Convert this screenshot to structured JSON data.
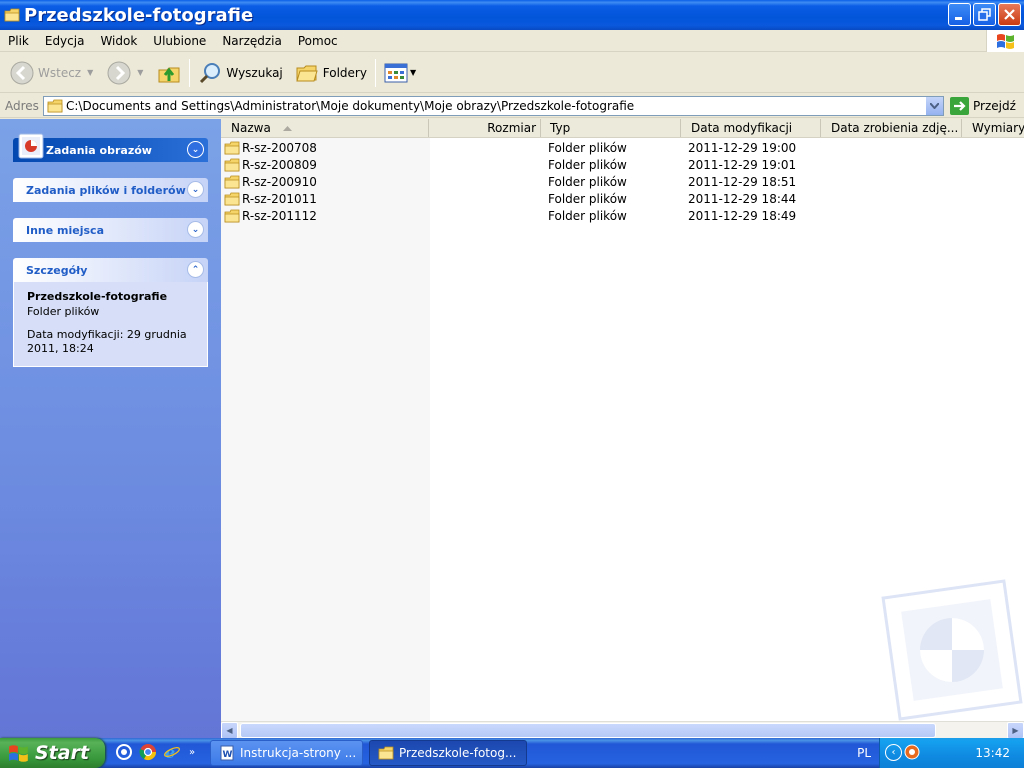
{
  "window": {
    "title": "Przedszkole-fotografie"
  },
  "menu": {
    "items": [
      "Plik",
      "Edycja",
      "Widok",
      "Ulubione",
      "Narzędzia",
      "Pomoc"
    ]
  },
  "toolbar": {
    "back_label": "Wstecz",
    "search_label": "Wyszukaj",
    "folders_label": "Foldery"
  },
  "address": {
    "label": "Adres",
    "path": "C:\\Documents and Settings\\Administrator\\Moje dokumenty\\Moje obrazy\\Przedszkole-fotografie",
    "go_label": "Przejdź"
  },
  "taskpane": {
    "picture_tasks": "Zadania obrazów",
    "file_tasks": "Zadania plików i folderów",
    "other_places": "Inne miejsca",
    "details": {
      "header": "Szczegóły",
      "name": "Przedszkole-fotografie",
      "type": "Folder plików",
      "modified": "Data modyfikacji: 29 grudnia 2011, 18:24"
    }
  },
  "columns": {
    "name": "Nazwa",
    "size": "Rozmiar",
    "type": "Typ",
    "modified": "Data modyfikacji",
    "taken": "Data zrobienia zdję...",
    "dimensions": "Wymiary"
  },
  "files": [
    {
      "name": "R-sz-200708",
      "type": "Folder plików",
      "modified": "2011-12-29 19:00"
    },
    {
      "name": "R-sz-200809",
      "type": "Folder plików",
      "modified": "2011-12-29 19:01"
    },
    {
      "name": "R-sz-200910",
      "type": "Folder plików",
      "modified": "2011-12-29 18:51"
    },
    {
      "name": "R-sz-201011",
      "type": "Folder plików",
      "modified": "2011-12-29 18:44"
    },
    {
      "name": "R-sz-201112",
      "type": "Folder plików",
      "modified": "2011-12-29 18:49"
    }
  ],
  "taskbar": {
    "start_label": "Start",
    "tasks": [
      {
        "label": "Instrukcja-strony ..."
      },
      {
        "label": "Przedszkole-fotog..."
      }
    ],
    "language": "PL",
    "clock": "13:42"
  },
  "colors": {
    "titlebar": "#0255d9",
    "taskpane": "#7ba2e7",
    "start": "#3c9a3c"
  }
}
